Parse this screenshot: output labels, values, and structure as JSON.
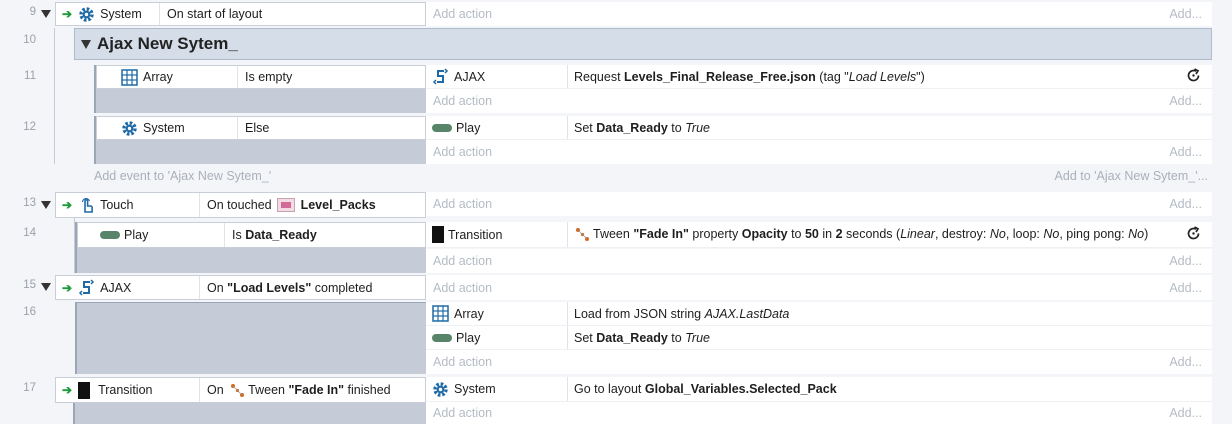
{
  "line_numbers": {
    "l9": "9",
    "l10": "10",
    "l11": "11",
    "l12": "12",
    "l13": "13",
    "l14": "14",
    "l15": "15",
    "l16": "16",
    "l17": "17"
  },
  "add_action": "Add action",
  "add_ellipsis": "Add...",
  "group": {
    "title": "Ajax New Sytem_",
    "add_event": "Add event to 'Ajax New Sytem_'",
    "add_to": "Add to 'Ajax New Sytem_'..."
  },
  "e9": {
    "object": "System",
    "condition": "On start of layout"
  },
  "e11": {
    "object": "Array",
    "condition": "Is empty",
    "a_object": "AJAX",
    "a_pre": "Request ",
    "a_file": "Levels_Final_Release_Free.json",
    "a_mid": " (tag \"",
    "a_tag": "Load Levels",
    "a_post": "\")"
  },
  "e12": {
    "object": "System",
    "condition": "Else",
    "a_object": "Play",
    "a_pre": "Set ",
    "a_var": "Data_Ready",
    "a_to": " to ",
    "a_val": "True"
  },
  "e13": {
    "object": "Touch",
    "c_pre": "On touched ",
    "c_obj": "Level_Packs"
  },
  "e14": {
    "object": "Play",
    "c_pre": "Is ",
    "c_var": "Data_Ready",
    "a_object": "Transition",
    "t_pre": "Tween ",
    "t_name": "\"Fade In\"",
    "t_prop": " property ",
    "t_opacity": "Opacity",
    "t_to": " to ",
    "t_val": "50",
    "t_in": " in ",
    "t_dur": "2",
    "t_sec": " seconds (",
    "t_linear": "Linear",
    "t_destroy": ", destroy: ",
    "t_no1": "No",
    "t_loop": ", loop: ",
    "t_no2": "No",
    "t_pp": ", ping pong: ",
    "t_no3": "No",
    "t_end": ")"
  },
  "e15": {
    "object": "AJAX",
    "c_pre": "On ",
    "c_tag": "\"Load Levels\"",
    "c_post": " completed"
  },
  "e16": {
    "a1_object": "Array",
    "a1_pre": "Load from JSON string ",
    "a1_expr": "AJAX.LastData",
    "a2_object": "Play",
    "a2_pre": "Set ",
    "a2_var": "Data_Ready",
    "a2_to": " to ",
    "a2_val": "True"
  },
  "e17": {
    "object": "Transition",
    "c_pre": "On ",
    "c_tween": "Tween ",
    "c_name": "\"Fade In\"",
    "c_post": " finished",
    "a_object": "System",
    "a_pre": "Go to layout ",
    "a_layout": "Global_Variables.Selected_Pack"
  },
  "colors": {
    "trigger_arrow": "#1c9a3c",
    "event_bar": "#c5ccd8",
    "group_bg": "#d5dde8",
    "play_icon": "#58856a"
  },
  "icons": [
    "gear-icon",
    "grid-icon",
    "ajax-icon",
    "touch-icon",
    "play-icon",
    "transition-icon",
    "tween-icon",
    "redo-icon",
    "sprite-icon"
  ]
}
